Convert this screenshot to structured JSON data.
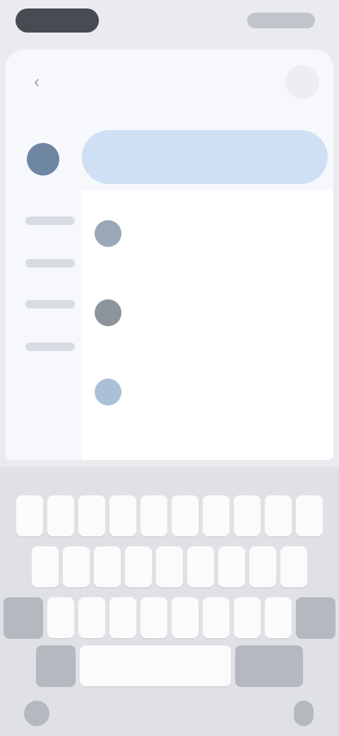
{
  "status": {
    "time": "",
    "icons": ""
  },
  "header": {
    "back_icon": "back-arrow-icon",
    "menu_icon": "menu-icon"
  },
  "search": {
    "placeholder": ""
  },
  "list": {
    "section": "",
    "rows": [
      {
        "label": "",
        "avatar_color": "#9aa7b9"
      },
      {
        "label": "",
        "avatar_color": ""
      },
      {
        "label": "",
        "avatar_color": "#8e949c"
      },
      {
        "label": "",
        "avatar_color": ""
      },
      {
        "label": "",
        "avatar_color": "#a9c0d8"
      }
    ]
  },
  "keyboard": {
    "row1": [
      "",
      "",
      "",
      "",
      "",
      "",
      "",
      "",
      "",
      ""
    ],
    "row2": [
      "",
      "",
      "",
      "",
      "",
      "",
      "",
      "",
      ""
    ],
    "row3": [
      "",
      "",
      "",
      "",
      "",
      "",
      "",
      ""
    ],
    "row4": {
      "mode": "",
      "space": "",
      "enter": ""
    }
  }
}
